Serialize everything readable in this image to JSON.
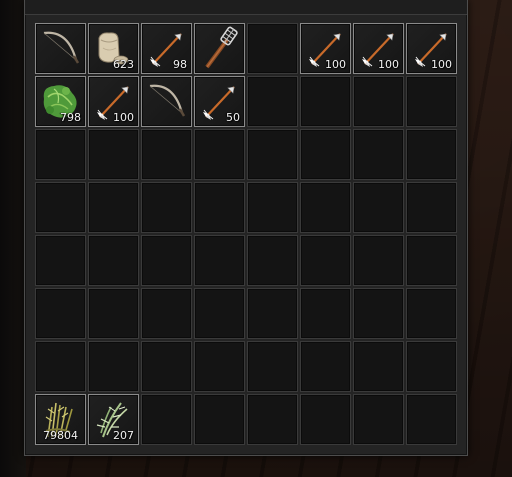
{
  "inventory": {
    "rows": 8,
    "columns": 8,
    "items": [
      {
        "slot": 0,
        "icon": "bow-icon",
        "count": ""
      },
      {
        "slot": 1,
        "icon": "cloth-sack-icon",
        "count": "623"
      },
      {
        "slot": 2,
        "icon": "arrow-icon",
        "count": "98"
      },
      {
        "slot": 3,
        "icon": "torch-icon",
        "count": ""
      },
      {
        "slot": 5,
        "icon": "arrow-icon",
        "count": "100"
      },
      {
        "slot": 6,
        "icon": "arrow-icon",
        "count": "100"
      },
      {
        "slot": 7,
        "icon": "arrow-icon",
        "count": "100"
      },
      {
        "slot": 8,
        "icon": "green-leaves-icon",
        "count": "798"
      },
      {
        "slot": 9,
        "icon": "arrow-icon",
        "count": "100"
      },
      {
        "slot": 10,
        "icon": "bow-icon",
        "count": ""
      },
      {
        "slot": 11,
        "icon": "arrow-icon",
        "count": "50"
      },
      {
        "slot": 56,
        "icon": "reed-bundle-icon",
        "count": "79804"
      },
      {
        "slot": 57,
        "icon": "plant-fiber-icon",
        "count": "207"
      }
    ]
  },
  "colors": {
    "panel": "#242424",
    "slot_empty": "#141414",
    "slot_border_filled": "#8a8a8a",
    "count_text": "#f2f2f2"
  }
}
